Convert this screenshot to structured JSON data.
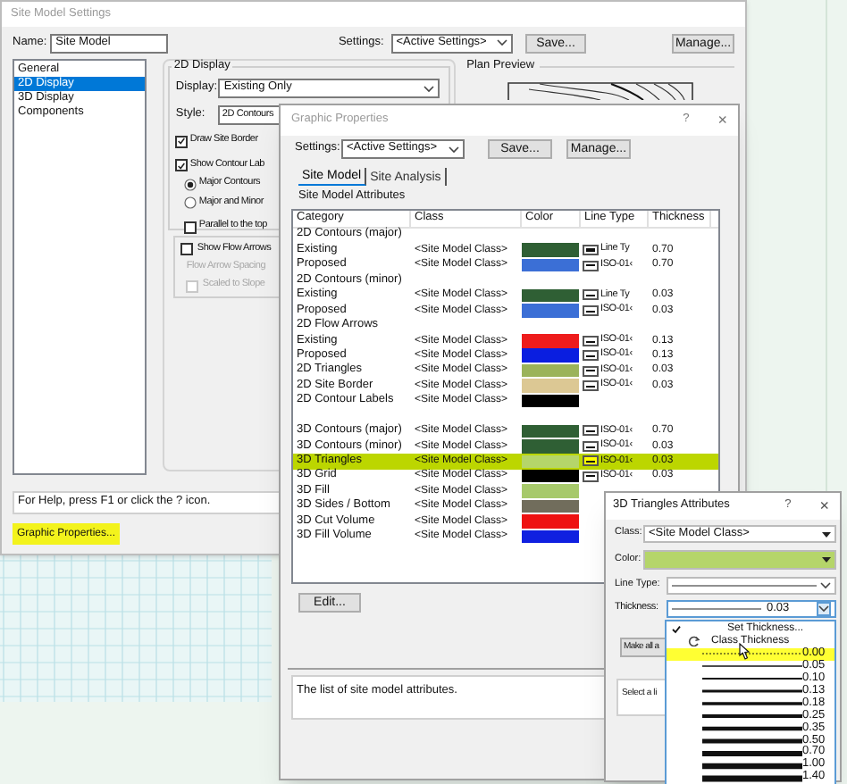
{
  "site_model_settings": {
    "title": "Site Model Settings",
    "name_label": "Name:",
    "name_value": "Site Model",
    "settings_label": "Settings:",
    "settings_value": "<Active Settings>",
    "buttons": [
      "Save...",
      "Manage..."
    ],
    "nav": [
      {
        "label": "General",
        "selected": false
      },
      {
        "label": "2D Display",
        "selected": true
      },
      {
        "label": "3D Display",
        "selected": false
      },
      {
        "label": "Components",
        "selected": false
      }
    ],
    "display_group": {
      "title": "2D Display",
      "display_label": "Display:",
      "display_value": "Existing Only",
      "style_label": "Style:",
      "style_value": "2D Contours",
      "options": [
        {
          "kind": "checkbox",
          "label": "Draw Site Border",
          "checked": true,
          "indent": false
        },
        {
          "kind": "checkbox",
          "label": "Show Contour Lab",
          "checked": true,
          "indent": false
        },
        {
          "kind": "radio",
          "label": "Major Contours",
          "selected": true,
          "indent": true
        },
        {
          "kind": "radio",
          "label": "Major and Minor",
          "selected": false,
          "indent": true
        },
        {
          "kind": "checkbox",
          "label": "Parallel to the top",
          "checked": false,
          "indent": true
        }
      ]
    },
    "flow_group": {
      "show_flow_arrows": {
        "label": "Show Flow Arrows",
        "checked": false
      },
      "spacing_label": "Flow Arrow Spacing",
      "scaled_to_slope": {
        "label": "Scaled to Slope",
        "checked": false,
        "disabled": true
      }
    },
    "plan_preview_label": "Plan Preview",
    "help_text": "For Help, press F1 or click the ? icon.",
    "graphic_properties_button": "Graphic Properties..."
  },
  "graphic_properties": {
    "title": "Graphic Properties",
    "help": "?",
    "close": "×",
    "settings_label": "Settings:",
    "settings_value": "<Active Settings>",
    "buttons": [
      "Save...",
      "Manage..."
    ],
    "tabs": [
      {
        "label": "Site Model",
        "selected": true
      },
      {
        "label": "Site Analysis",
        "selected": false
      }
    ],
    "section_label": "Site Model Attributes",
    "columns": [
      "Category",
      "Class",
      "Color",
      "Line Type",
      "Thickness"
    ],
    "rows": [
      {
        "kind": "group",
        "category": "2D Contours (major)",
        "selected": false
      },
      {
        "kind": "item",
        "category": "Existing",
        "class": "<Site Model Class>",
        "color": "#2f5f34",
        "line_type": "Line Ty",
        "thickness": "0.70",
        "selected": false
      },
      {
        "kind": "item",
        "category": "Proposed",
        "class": "<Site Model Class>",
        "color": "#3b6fd6",
        "line_type": "ISO-01‹",
        "thickness": "0.70",
        "selected": false
      },
      {
        "kind": "group",
        "category": "2D Contours (minor)",
        "selected": false
      },
      {
        "kind": "item",
        "category": "Existing",
        "class": "<Site Model Class>",
        "color": "#2f5f34",
        "line_type": "Line Ty",
        "thickness": "0.03",
        "selected": false
      },
      {
        "kind": "item",
        "category": "Proposed",
        "class": "<Site Model Class>",
        "color": "#3b6fd6",
        "line_type": "ISO-01‹",
        "thickness": "0.03",
        "selected": false
      },
      {
        "kind": "group",
        "category": "2D Flow Arrows",
        "selected": false
      },
      {
        "kind": "item",
        "category": "Existing",
        "class": "<Site Model Class>",
        "color": "#ee1c1c",
        "line_type": "ISO-01‹",
        "thickness": "0.13",
        "selected": false
      },
      {
        "kind": "item",
        "category": "Proposed",
        "class": "<Site Model Class>",
        "color": "#0a1ee0",
        "line_type": "ISO-01‹",
        "thickness": "0.13",
        "selected": false
      },
      {
        "kind": "item",
        "category": "2D Triangles",
        "class": "<Site Model Class>",
        "color": "#9bb35a",
        "line_type": "ISO-01‹",
        "thickness": "0.03",
        "selected": false
      },
      {
        "kind": "item",
        "category": "2D Site Border",
        "class": "<Site Model Class>",
        "color": "#dcc894",
        "line_type": "ISO-01‹",
        "thickness": "0.03",
        "selected": false
      },
      {
        "kind": "item",
        "category": "2D Contour Labels",
        "class": "<Site Model Class>",
        "color": "#000000",
        "selected": false
      },
      {
        "kind": "spacer",
        "selected": false
      },
      {
        "kind": "item",
        "category": "3D Contours (major)",
        "class": "<Site Model Class>",
        "color": "#2f5f34",
        "line_type": "ISO-01‹",
        "thickness": "0.70",
        "selected": false
      },
      {
        "kind": "item",
        "category": "3D Contours (minor)",
        "class": "<Site Model Class>",
        "color": "#2f5f34",
        "line_type": "ISO-01‹",
        "thickness": "0.03",
        "selected": false
      },
      {
        "kind": "item",
        "category": "3D Triangles",
        "class": "<Site Model Class>",
        "color": "#b5d56a",
        "line_type": "ISO-01‹",
        "thickness": "0.03",
        "selected": true
      },
      {
        "kind": "item",
        "category": "3D Grid",
        "class": "<Site Model Class>",
        "color": "#000000",
        "line_type": "ISO-01‹",
        "thickness": "0.03",
        "selected": false
      },
      {
        "kind": "item",
        "category": "3D Fill",
        "class": "<Site Model Class>",
        "color": "#a7c96b",
        "selected": false
      },
      {
        "kind": "item",
        "category": "3D Sides / Bottom",
        "class": "<Site Model Class>",
        "color": "#716d5c",
        "selected": false
      },
      {
        "kind": "item",
        "category": "3D Cut Volume",
        "class": "<Site Model Class>",
        "color": "#ee1111",
        "selected": false
      },
      {
        "kind": "item",
        "category": "3D Fill Volume",
        "class": "<Site Model Class>",
        "color": "#1020e0",
        "selected": false
      }
    ],
    "edit_button": "Edit...",
    "description": "The list of site model attributes."
  },
  "attributes_dialog": {
    "title": "3D Triangles Attributes",
    "help": "?",
    "close": "×",
    "class_label": "Class:",
    "class_value": "<Site Model Class>",
    "color_label": "Color:",
    "color": "#b5d56a",
    "line_type_label": "Line Type:",
    "thickness_label": "Thickness:",
    "thickness_value": "0.03",
    "make_all_button": "Make all a",
    "select_text": "Select a li",
    "thickness_menu": [
      {
        "kind": "command",
        "label": "Set Thickness...",
        "checked": true,
        "selected": false
      },
      {
        "kind": "class",
        "label": "Class Thickness",
        "checked": false,
        "selected": false
      },
      {
        "kind": "weight",
        "label": "0.00",
        "selected": true
      },
      {
        "kind": "weight",
        "label": "0.05",
        "selected": false
      },
      {
        "kind": "weight",
        "label": "0.10",
        "selected": false
      },
      {
        "kind": "weight",
        "label": "0.13",
        "selected": false
      },
      {
        "kind": "weight",
        "label": "0.18",
        "selected": false
      },
      {
        "kind": "weight",
        "label": "0.25",
        "selected": false
      },
      {
        "kind": "weight",
        "label": "0.35",
        "selected": false
      },
      {
        "kind": "weight",
        "label": "0.50",
        "selected": false
      },
      {
        "kind": "weight",
        "label": "0.70",
        "selected": false
      },
      {
        "kind": "weight",
        "label": "1.00",
        "selected": false
      },
      {
        "kind": "weight",
        "label": "1.40",
        "selected": false
      }
    ]
  }
}
